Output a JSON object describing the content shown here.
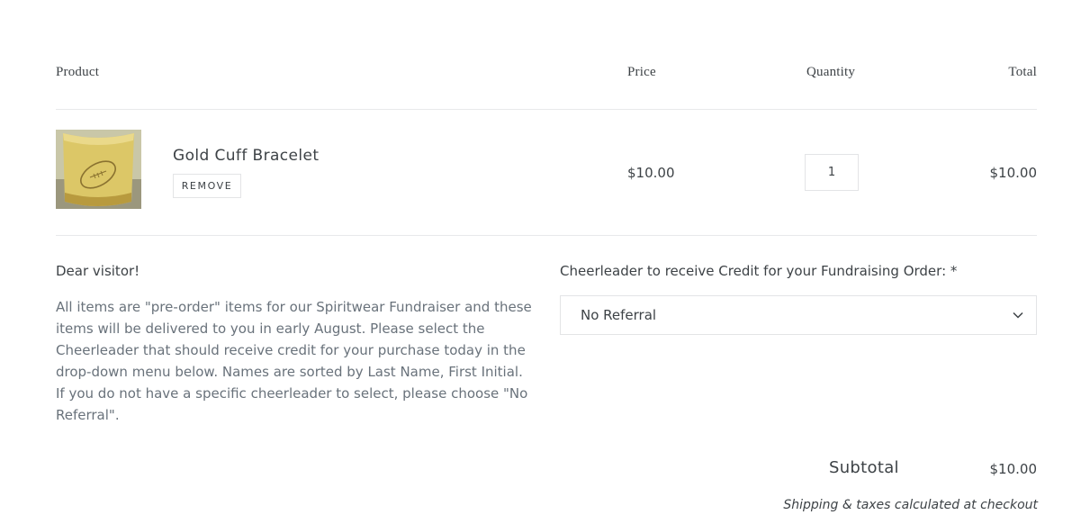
{
  "table_header": {
    "product": "Product",
    "price": "Price",
    "quantity": "Quantity",
    "total": "Total"
  },
  "cart_item": {
    "name": "Gold Cuff Bracelet",
    "remove_label": "REMOVE",
    "price": "$10.00",
    "quantity": "1",
    "line_total": "$10.00",
    "thumbnail_icon": "gold-cuff-football-image"
  },
  "note": {
    "greeting": "Dear visitor!",
    "body": "All items are \"pre-order\" items for our Spiritwear Fundraiser and these items will be delivered to you in early August. Please select the Cheerleader that should receive credit for your purchase today in the drop-down menu below. Names are sorted by Last Name, First Initial. If you do not have a specific cheerleader to select, please choose \"No Referral\"."
  },
  "referral": {
    "label": "Cheerleader to receive Credit for your Fundraising Order: *",
    "selected": "No Referral"
  },
  "totals": {
    "subtotal_label": "Subtotal",
    "subtotal_value": "$10.00",
    "shipping_note": "Shipping & taxes calculated at checkout"
  },
  "colors": {
    "text": "#3d4246",
    "muted_text": "#69727b",
    "border": "#e3e4e6",
    "gold": "#d8c15a"
  }
}
